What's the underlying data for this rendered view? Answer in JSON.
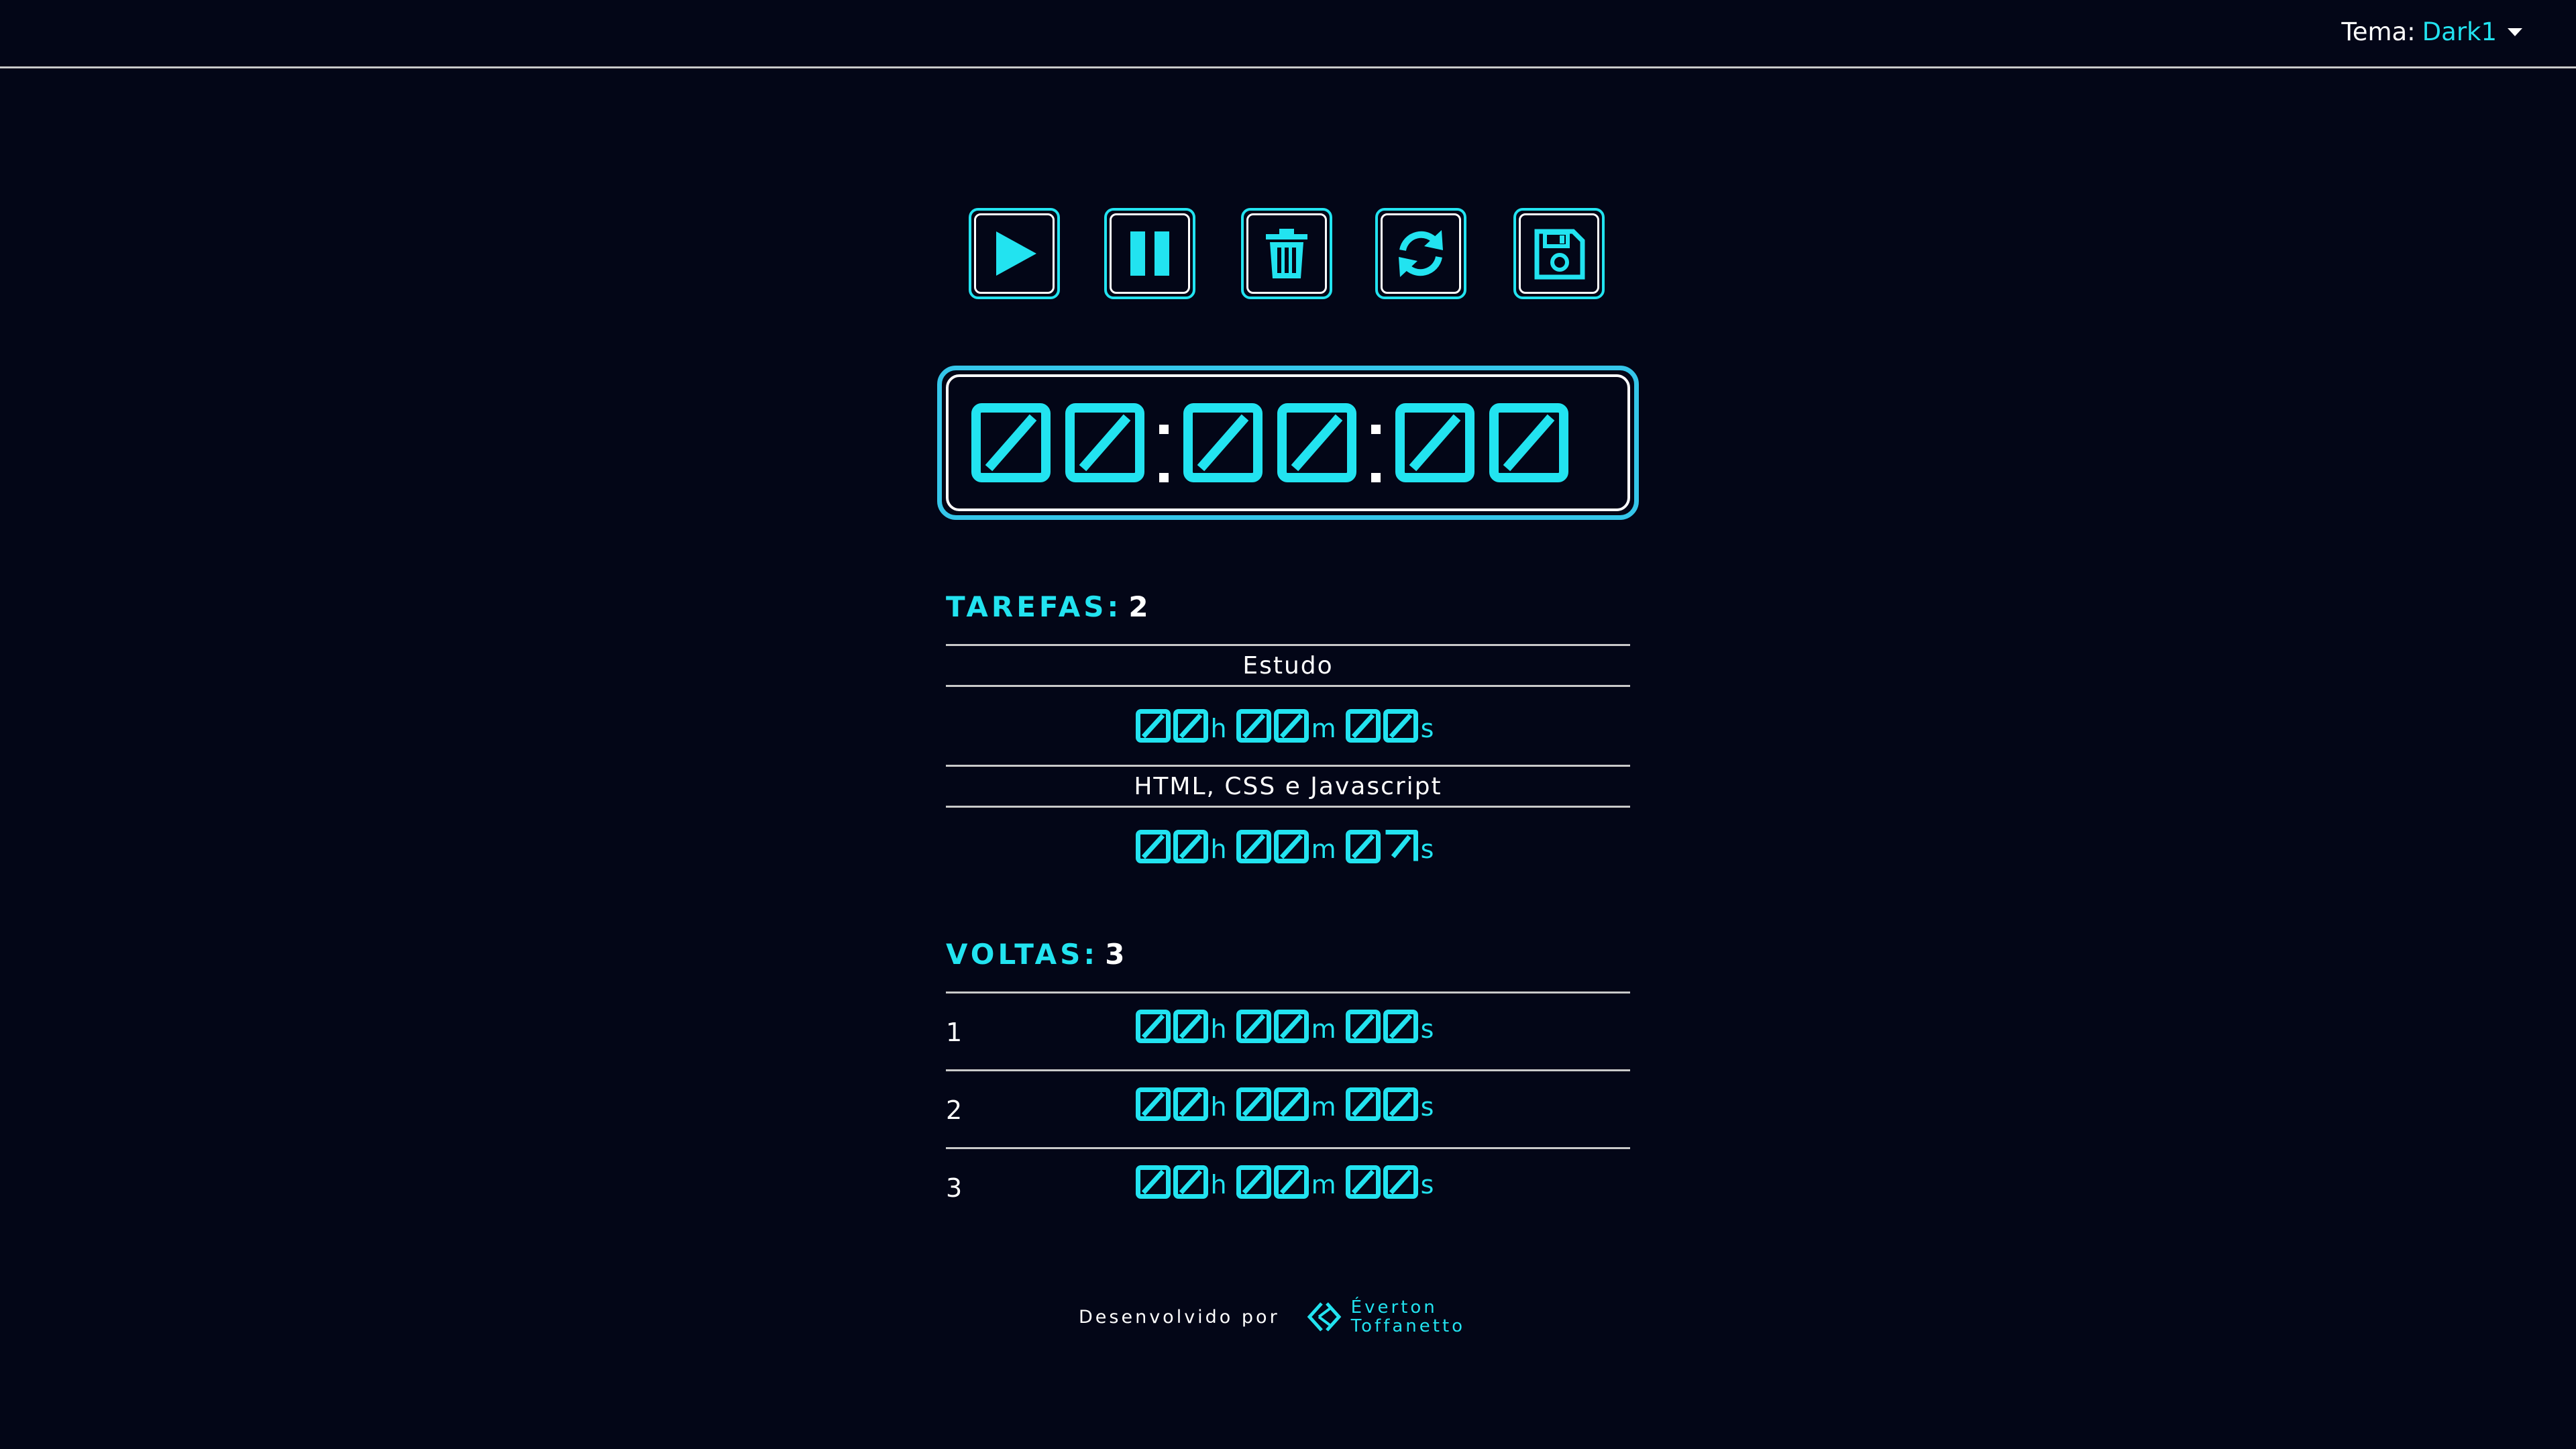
{
  "header": {
    "theme_label": "Tema:",
    "theme_value": "Dark1"
  },
  "controls": {
    "play_icon": "play-icon",
    "pause_icon": "pause-icon",
    "delete_icon": "trash-icon",
    "reset_icon": "refresh-icon",
    "save_icon": "floppy-disk-icon"
  },
  "timer": {
    "hours": "00",
    "minutes": "00",
    "seconds": "00"
  },
  "tasks": {
    "label": "TAREFAS:",
    "count": "2",
    "items": [
      {
        "name": "Estudo",
        "h": "00",
        "m": "00",
        "s": "00"
      },
      {
        "name": "HTML, CSS e Javascript",
        "h": "00",
        "m": "00",
        "s": "07"
      }
    ]
  },
  "laps": {
    "label": "VOLTAS:",
    "count": "3",
    "items": [
      {
        "num": "1",
        "h": "00",
        "m": "00",
        "s": "00"
      },
      {
        "num": "2",
        "h": "00",
        "m": "00",
        "s": "00"
      },
      {
        "num": "3",
        "h": "00",
        "m": "00",
        "s": "00"
      }
    ]
  },
  "units": {
    "h": "h",
    "m": "m",
    "s": "s"
  },
  "footer": {
    "developed_by": "Desenvolvido por",
    "author_first": "Éverton",
    "author_last": "Toffanetto"
  },
  "colors": {
    "accent": "#22e3f0",
    "background": "#030617",
    "divider": "#c9c9c9"
  }
}
